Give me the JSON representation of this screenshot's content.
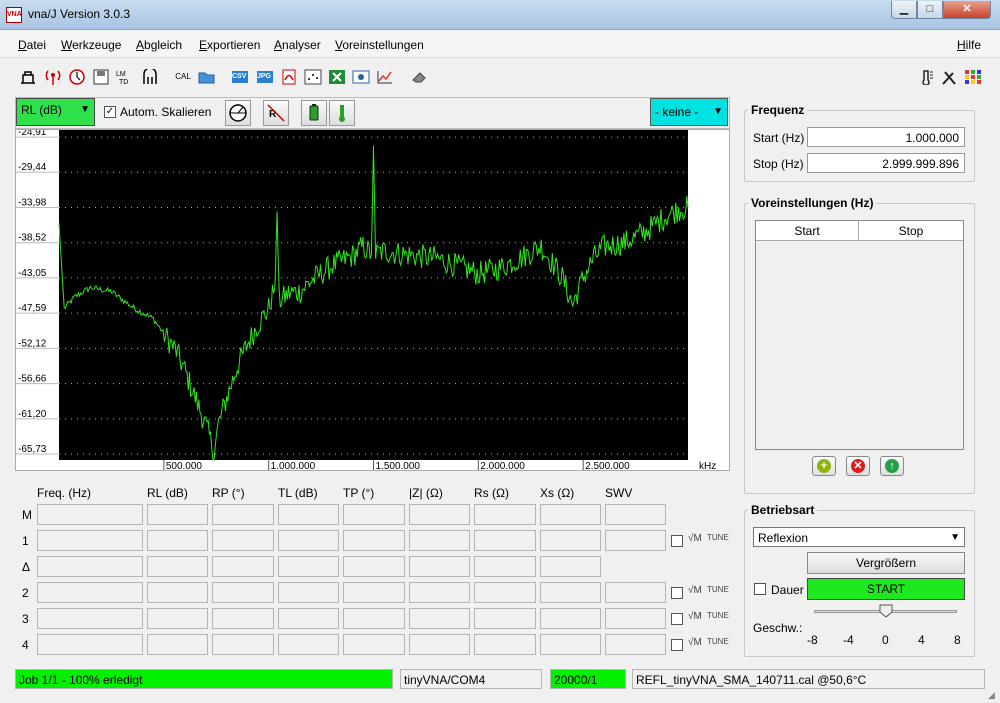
{
  "window": {
    "title": "vna/J Version 3.0.3",
    "app_icon_text": "VNA"
  },
  "menu": {
    "items": [
      "Datei",
      "Werkzeuge",
      "Abgleich",
      "Exportieren",
      "Analyser",
      "Voreinstellungen"
    ],
    "help": "Hilfe"
  },
  "toolbar": {
    "icons": [
      "calibrate-icon",
      "antenna-icon",
      "clock-icon",
      "save-icon",
      "mathematics-icon",
      "connector-icon",
      "cal-icon",
      "folder-open-icon",
      "csv-icon",
      "jpg-icon",
      "pdf-icon",
      "scatter-icon",
      "excel-icon",
      "export-icon",
      "chart-icon",
      "eraser-icon"
    ],
    "cal_label": "CAL",
    "csv_label": "CSV",
    "jpg_label": "JPG",
    "right_icons": [
      "thermometer-icon",
      "tools-icon",
      "grid-icon"
    ]
  },
  "chart_controls": {
    "scale_select": "RL (dB)",
    "auto_scale_label": "Autom. Skalieren",
    "auto_scale_checked": true,
    "series_select": "- keine -"
  },
  "chart_data": {
    "type": "line",
    "y_ticks": [
      "-24,91",
      "-29,44",
      "-33,98",
      "-38,52",
      "-43,05",
      "-47,59",
      "-52,12",
      "-56,66",
      "-61,20",
      "-65,73"
    ],
    "x_ticks": [
      "500.000",
      "1.000.000",
      "1.500.000",
      "2.000.000",
      "2.500.000"
    ],
    "x_unit": "kHz",
    "xlim": [
      1,
      3000000
    ],
    "ylim": [
      -66.5,
      -24.0
    ],
    "grid": true,
    "background": "#000000",
    "line_color": "#32e61e",
    "series": [
      {
        "x": [
          1,
          25000,
          75000,
          150000,
          250000,
          350000,
          450000,
          520000,
          560000,
          600000,
          650000,
          700000,
          740000,
          760000,
          800000,
          850000,
          900000,
          950000,
          1000000,
          1030000,
          1040000,
          1050000,
          1100000,
          1150000,
          1200000,
          1300000,
          1400000,
          1450000,
          1490000,
          1500000,
          1510000,
          1550000,
          1600000,
          1700000,
          1800000,
          1900000,
          2000000,
          2100000,
          2200000,
          2300000,
          2400000,
          2450000,
          2500000,
          2550000,
          2600000,
          2700000,
          2800000,
          2900000,
          2960000,
          3000000
        ],
        "y": [
          -36.0,
          -47.0,
          -45.5,
          -44.3,
          -44.8,
          -46.8,
          -48.3,
          -51.0,
          -52.5,
          -55.0,
          -58.5,
          -62.0,
          -65.5,
          -62.0,
          -58.5,
          -54.5,
          -51.5,
          -49.0,
          -47.0,
          -44.0,
          -34.5,
          -46.0,
          -45.0,
          -44.8,
          -43.5,
          -41.5,
          -40.2,
          -39.0,
          -40.0,
          -26.0,
          -40.0,
          -39.6,
          -39.8,
          -40.2,
          -40.5,
          -41.5,
          -42.5,
          -41.8,
          -40.5,
          -39.0,
          -43.0,
          -46.5,
          -43.0,
          -40.5,
          -39.0,
          -38.5,
          -37.0,
          -35.0,
          -34.2,
          -34.0
        ]
      }
    ]
  },
  "readout": {
    "columns": [
      "Freq. (Hz)",
      "RL (dB)",
      "RP (°)",
      "TL (dB)",
      "TP (°)",
      "|Z| (Ω)",
      "Rs (Ω)",
      "Xs (Ω)",
      "SWV"
    ],
    "rows": [
      "M",
      "1",
      "Δ",
      "2",
      "3",
      "4"
    ],
    "tune_sqrt": "√M",
    "tune_label": "TUNE"
  },
  "frequency": {
    "title": "Frequenz",
    "start_label": "Start (Hz)",
    "start_value": "1.000.000",
    "stop_label": "Stop (Hz)",
    "stop_value": "2.999.999.896"
  },
  "presets": {
    "title": "Voreinstellungen (Hz)",
    "col_start": "Start",
    "col_stop": "Stop"
  },
  "mode": {
    "title": "Betriebsart",
    "mode_select": "Reflexion",
    "zoom_button": "Vergrößern",
    "continuous_label": "Dauer",
    "start_button": "START",
    "speed_label": "Geschw.:",
    "speed_ticks": [
      "-8",
      "-4",
      "0",
      "4",
      "8"
    ],
    "speed_value": 0
  },
  "status": {
    "job": "Job 1/1 - 100% erledigt",
    "device": "tinyVNA/COM4",
    "samples": "20000/1",
    "calibration": "REFL_tinyVNA_SMA_140711.cal @50,6°C"
  }
}
